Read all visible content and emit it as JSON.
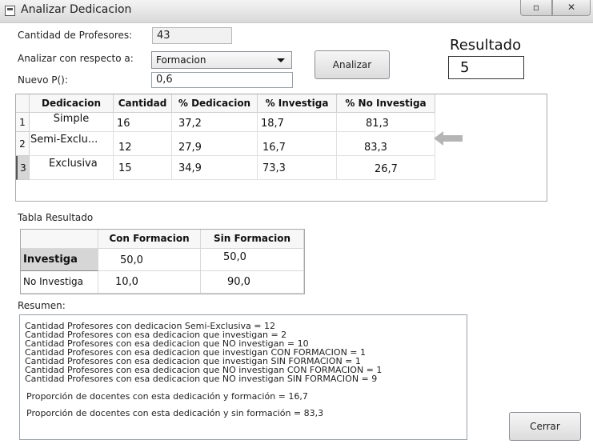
{
  "window": {
    "title": "Analizar Dedicacion",
    "restore_glyph": "▫",
    "close_glyph": "✕"
  },
  "form": {
    "cantidad_label": "Cantidad de Profesores:",
    "cantidad_value": "43",
    "analizar_label": "Analizar con respecto a:",
    "analizar_selected": "Formacion",
    "nuevo_label": "Nuevo P():",
    "nuevo_value": "0,6",
    "analizar_button": "Analizar"
  },
  "resultado": {
    "title": "Resultado",
    "value": "5"
  },
  "table1": {
    "columns": [
      "Dedicacion",
      "Cantidad",
      "% Dedicacion",
      "% Investiga",
      "% No Investiga"
    ],
    "rows": [
      {
        "num": "1",
        "dedicacion": "Simple",
        "cantidad": "16",
        "pct_dedicacion": "37,2",
        "pct_investiga": "18,7",
        "pct_no_investiga": "81,3"
      },
      {
        "num": "2",
        "dedicacion": "Semi-Exclu...",
        "cantidad": "12",
        "pct_dedicacion": "27,9",
        "pct_investiga": "16,7",
        "pct_no_investiga": "83,3"
      },
      {
        "num": "3",
        "dedicacion": "Exclusiva",
        "cantidad": "15",
        "pct_dedicacion": "34,9",
        "pct_investiga": "73,3",
        "pct_no_investiga": "26,7"
      }
    ]
  },
  "table2": {
    "label": "Tabla Resultado",
    "columns": [
      "Con Formacion",
      "Sin Formacion"
    ],
    "rows": [
      {
        "label": "Investiga",
        "con": "50,0",
        "sin": "50,0"
      },
      {
        "label": "No Investiga",
        "con": "10,0",
        "sin": "90,0"
      }
    ]
  },
  "resumen": {
    "label": "Resumen:",
    "lines": [
      "Cantidad Profesores con dedicacion Semi-Exclusiva = 12",
      "Cantidad Profesores con esa dedicacion que investigan  = 2",
      "Cantidad Profesores con esa dedicacion que NO investigan  = 10",
      "Cantidad Profesores con esa dedicacion que investigan CON FORMACION  =  1",
      "Cantidad Profesores con esa dedicacion que investigan SIN FORMACION  =  1",
      "Cantidad Profesores con esa dedicacion que NO investigan CON FORMACION  = 1",
      "Cantidad Profesores con esa dedicacion que NO investigan SIN FORMACION  =  9",
      "Proporción de docentes con esta dedicación y formación = 16,7",
      "Proporción de docentes con esta dedicación y sin formación = 83,3"
    ]
  },
  "buttons": {
    "cerrar": "Cerrar"
  },
  "colors": {
    "selected_row_header": "#d6d6d6",
    "arrow": "#b5b5b5"
  }
}
